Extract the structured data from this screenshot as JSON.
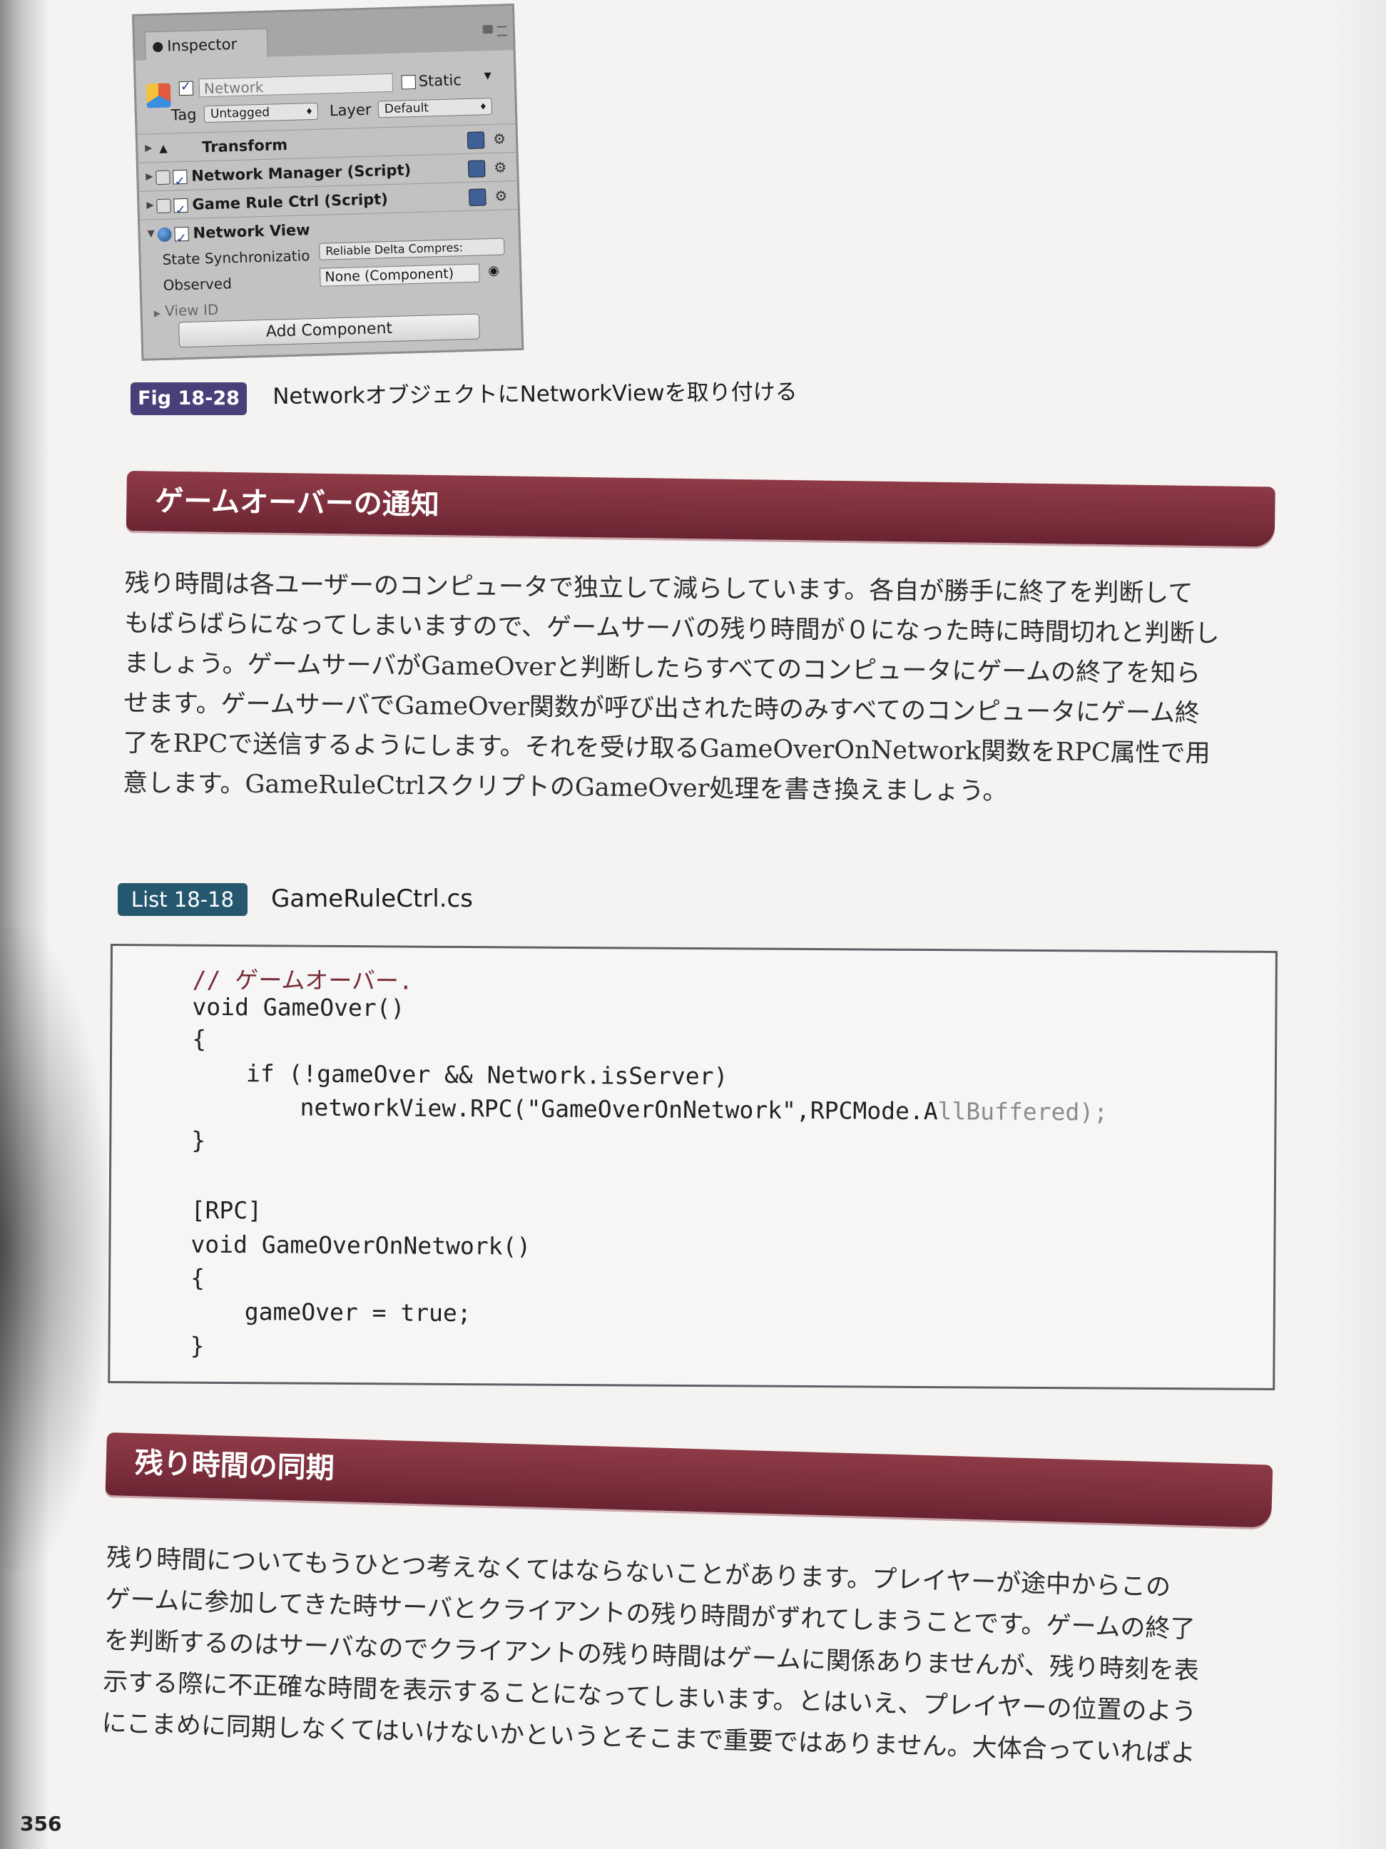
{
  "inspector": {
    "tab_label": "Inspector",
    "object_name": "Network",
    "static_label": "Static",
    "tag_label": "Tag",
    "tag_value": "Untagged",
    "layer_label": "Layer",
    "layer_value": "Default",
    "components": [
      {
        "label": "Transform"
      },
      {
        "label": "Network Manager (Script)"
      },
      {
        "label": "Game Rule Ctrl (Script)"
      },
      {
        "label": "Network View"
      }
    ],
    "state_sync_label": "State Synchronizatio",
    "state_sync_value": "Reliable Delta Compres:",
    "observed_label": "Observed",
    "observed_value": "None (Component)",
    "view_id_label": "View ID",
    "add_component_label": "Add Component"
  },
  "figure": {
    "badge": "Fig 18-28",
    "caption": "NetworkオブジェクトにNetworkViewを取り付ける"
  },
  "section1": {
    "heading": "ゲームオーバーの通知",
    "lines": [
      "残り時間は各ユーザーのコンピュータで独立して減らしています。各自が勝手に終了を判断して",
      "もばらばらになってしまいますので、ゲームサーバの残り時間が０になった時に時間切れと判断し",
      "ましょう。ゲームサーバがGameOverと判断したらすべてのコンピュータにゲームの終了を知ら",
      "せます。ゲームサーバでGameOver関数が呼び出された時のみすべてのコンピュータにゲーム終",
      "了をRPCで送信するようにします。それを受け取るGameOverOnNetwork関数をRPC属性で用",
      "意します。GameRuleCtrlスクリプトのGameOver処理を書き換えましょう。"
    ]
  },
  "listing": {
    "badge": "List 18-18",
    "filename": "GameRuleCtrl.cs",
    "comment": "// ゲームオーバー.",
    "code": [
      "void GameOver()",
      "{",
      "if (!gameOver && Network.isServer)",
      "networkView.RPC(\"GameOverOnNetwork\",RPCMode.A",
      "llBuffered);",
      "}",
      "[RPC]",
      "void GameOverOnNetwork()",
      "{",
      "gameOver = true;",
      "}"
    ]
  },
  "section2": {
    "heading": "残り時間の同期",
    "lines": [
      "残り時間についてもうひとつ考えなくてはならないことがあります。プレイヤーが途中からこの",
      "ゲームに参加してきた時サーバとクライアントの残り時間がずれてしまうことです。ゲームの終了",
      "を判断するのはサーバなのでクライアントの残り時間はゲームに関係ありませんが、残り時刻を表",
      "示する際に不正確な時間を表示することになってしまいます。とはいえ、プレイヤーの位置のよう",
      "にこまめに同期しなくてはいけないかというとそこまで重要ではありません。大体合っていればよ"
    ]
  },
  "page_number": "356"
}
